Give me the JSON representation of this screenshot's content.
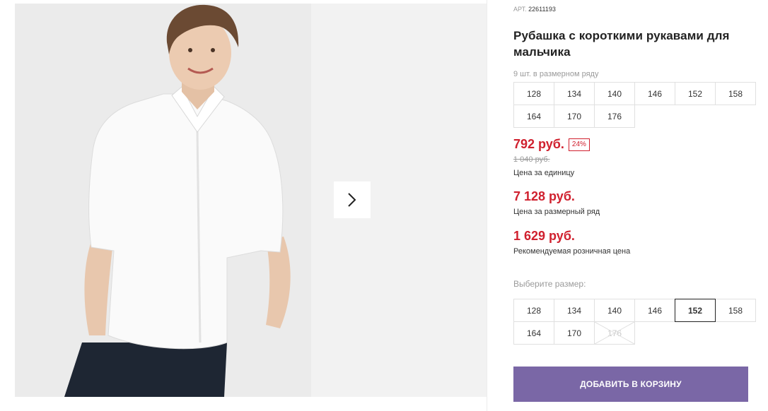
{
  "product": {
    "art_label": "АРТ.",
    "art_number": "22611193",
    "title": "Рубашка с короткими рукавами для мальчика",
    "pieces_in_row": "9 шт. в размерном ряду",
    "size_row": [
      "128",
      "134",
      "140",
      "146",
      "152",
      "158",
      "164",
      "170",
      "176"
    ]
  },
  "prices": {
    "unit_price": "792 руб.",
    "discount_badge": "24%",
    "old_price": "1 040 руб.",
    "unit_caption": "Цена за единицу",
    "row_price": "7 128 руб.",
    "row_caption": "Цена за размерный ряд",
    "retail_price": "1 629 руб.",
    "retail_caption": "Рекомендуемая розничная цена"
  },
  "size_picker": {
    "label": "Выберите размер:",
    "sizes": [
      {
        "value": "128",
        "state": "available"
      },
      {
        "value": "134",
        "state": "available"
      },
      {
        "value": "140",
        "state": "available"
      },
      {
        "value": "146",
        "state": "available"
      },
      {
        "value": "152",
        "state": "selected"
      },
      {
        "value": "158",
        "state": "available"
      },
      {
        "value": "164",
        "state": "available"
      },
      {
        "value": "170",
        "state": "available"
      },
      {
        "value": "176",
        "state": "unavailable"
      }
    ]
  },
  "actions": {
    "add_to_cart": "ДОБАВИТЬ В КОРЗИНУ"
  },
  "gallery": {
    "next_icon": "chevron-right-icon"
  },
  "colors": {
    "price_red": "#d0202e",
    "button_purple": "#7a67a6",
    "shirt": "#ffffff",
    "trousers": "#1e2633"
  }
}
